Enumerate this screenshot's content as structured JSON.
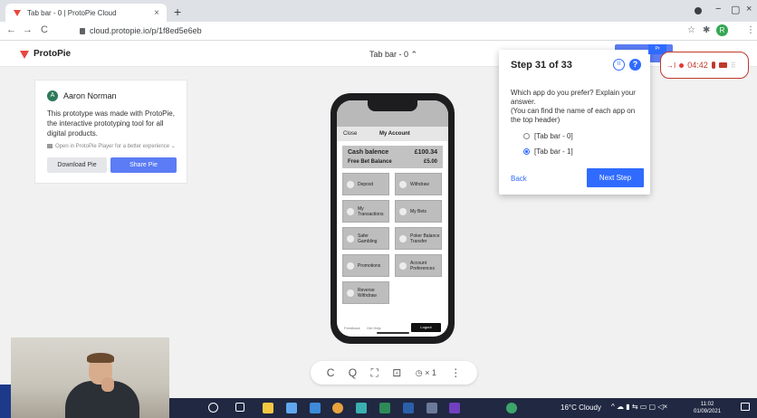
{
  "browser": {
    "tab_title": "Tab bar - 0 | ProtoPie Cloud",
    "tab_close": "×",
    "new_tab": "+",
    "url": "cloud.protopie.io/p/1f8ed5e6eb",
    "back": "←",
    "forward": "→",
    "reload": "C",
    "minimize": "−",
    "maximize": "▢",
    "close": "×",
    "star": "☆",
    "ext": "✱",
    "menu": "⋮",
    "profile_letter": "R"
  },
  "app": {
    "brand": "ProtoPie",
    "pie_name": "Tab bar - 0 ⌃",
    "accent": "#5b7cf5"
  },
  "info": {
    "author_initial": "A",
    "author": "Aaron Norman",
    "description": "This prototype was made with ProtoPie, the interactive prototyping tool for all digital products.",
    "player_note": "Open in ProtoPie Player for a better experience ⌄",
    "download_label": "Download Pie",
    "share_label": "Share Pie"
  },
  "phone": {
    "header_close": "Close",
    "header_title": "My Account",
    "cash_label": "Cash balence",
    "cash_value": "£100.34",
    "bet_label": "Free Bet Balance",
    "bet_value": "£5.00",
    "tiles": {
      "deposit": "Deposit",
      "withdraw": "Withdraw",
      "my_transactions": "My Transactions",
      "my_bets": "My Bets",
      "safer_gambling": "Safer Gambling",
      "poker_transfer": "Poker Balance Transfer",
      "promotions": "Promotions",
      "account_preferences": "Account Preferences",
      "reverse_withdraw": "Reverse Withdraw"
    },
    "footer_feedback": "Feedback",
    "footer_help": "Get Help",
    "logout": "Logout"
  },
  "playbar": {
    "restart": "C",
    "zoom": "Q",
    "fullscreen": "⛶",
    "screenshot": "⊡",
    "speed": "◷ × 1",
    "more": "⋮"
  },
  "task": {
    "step": "Step 31 of 33",
    "pause": "II",
    "help": "?",
    "question": "Which app do you prefer? Explain your answer.\n(You can find the name of each app on the top header)",
    "options": [
      "[Tab bar - 0]",
      "[Tab bar - 1]"
    ],
    "selected_index": 1,
    "back": "Back",
    "next": "Next Step",
    "accent": "#2f6bff"
  },
  "recorder": {
    "skip": "→I",
    "time": "04:42",
    "grip": "⠿",
    "tag": "Pr"
  },
  "taskbar": {
    "weather": "16°C  Cloudy",
    "time": "11:02",
    "date": "01/09/2021",
    "tray": "^ ☁ ▮ ⇆ ▭ ▢ ◁×"
  }
}
